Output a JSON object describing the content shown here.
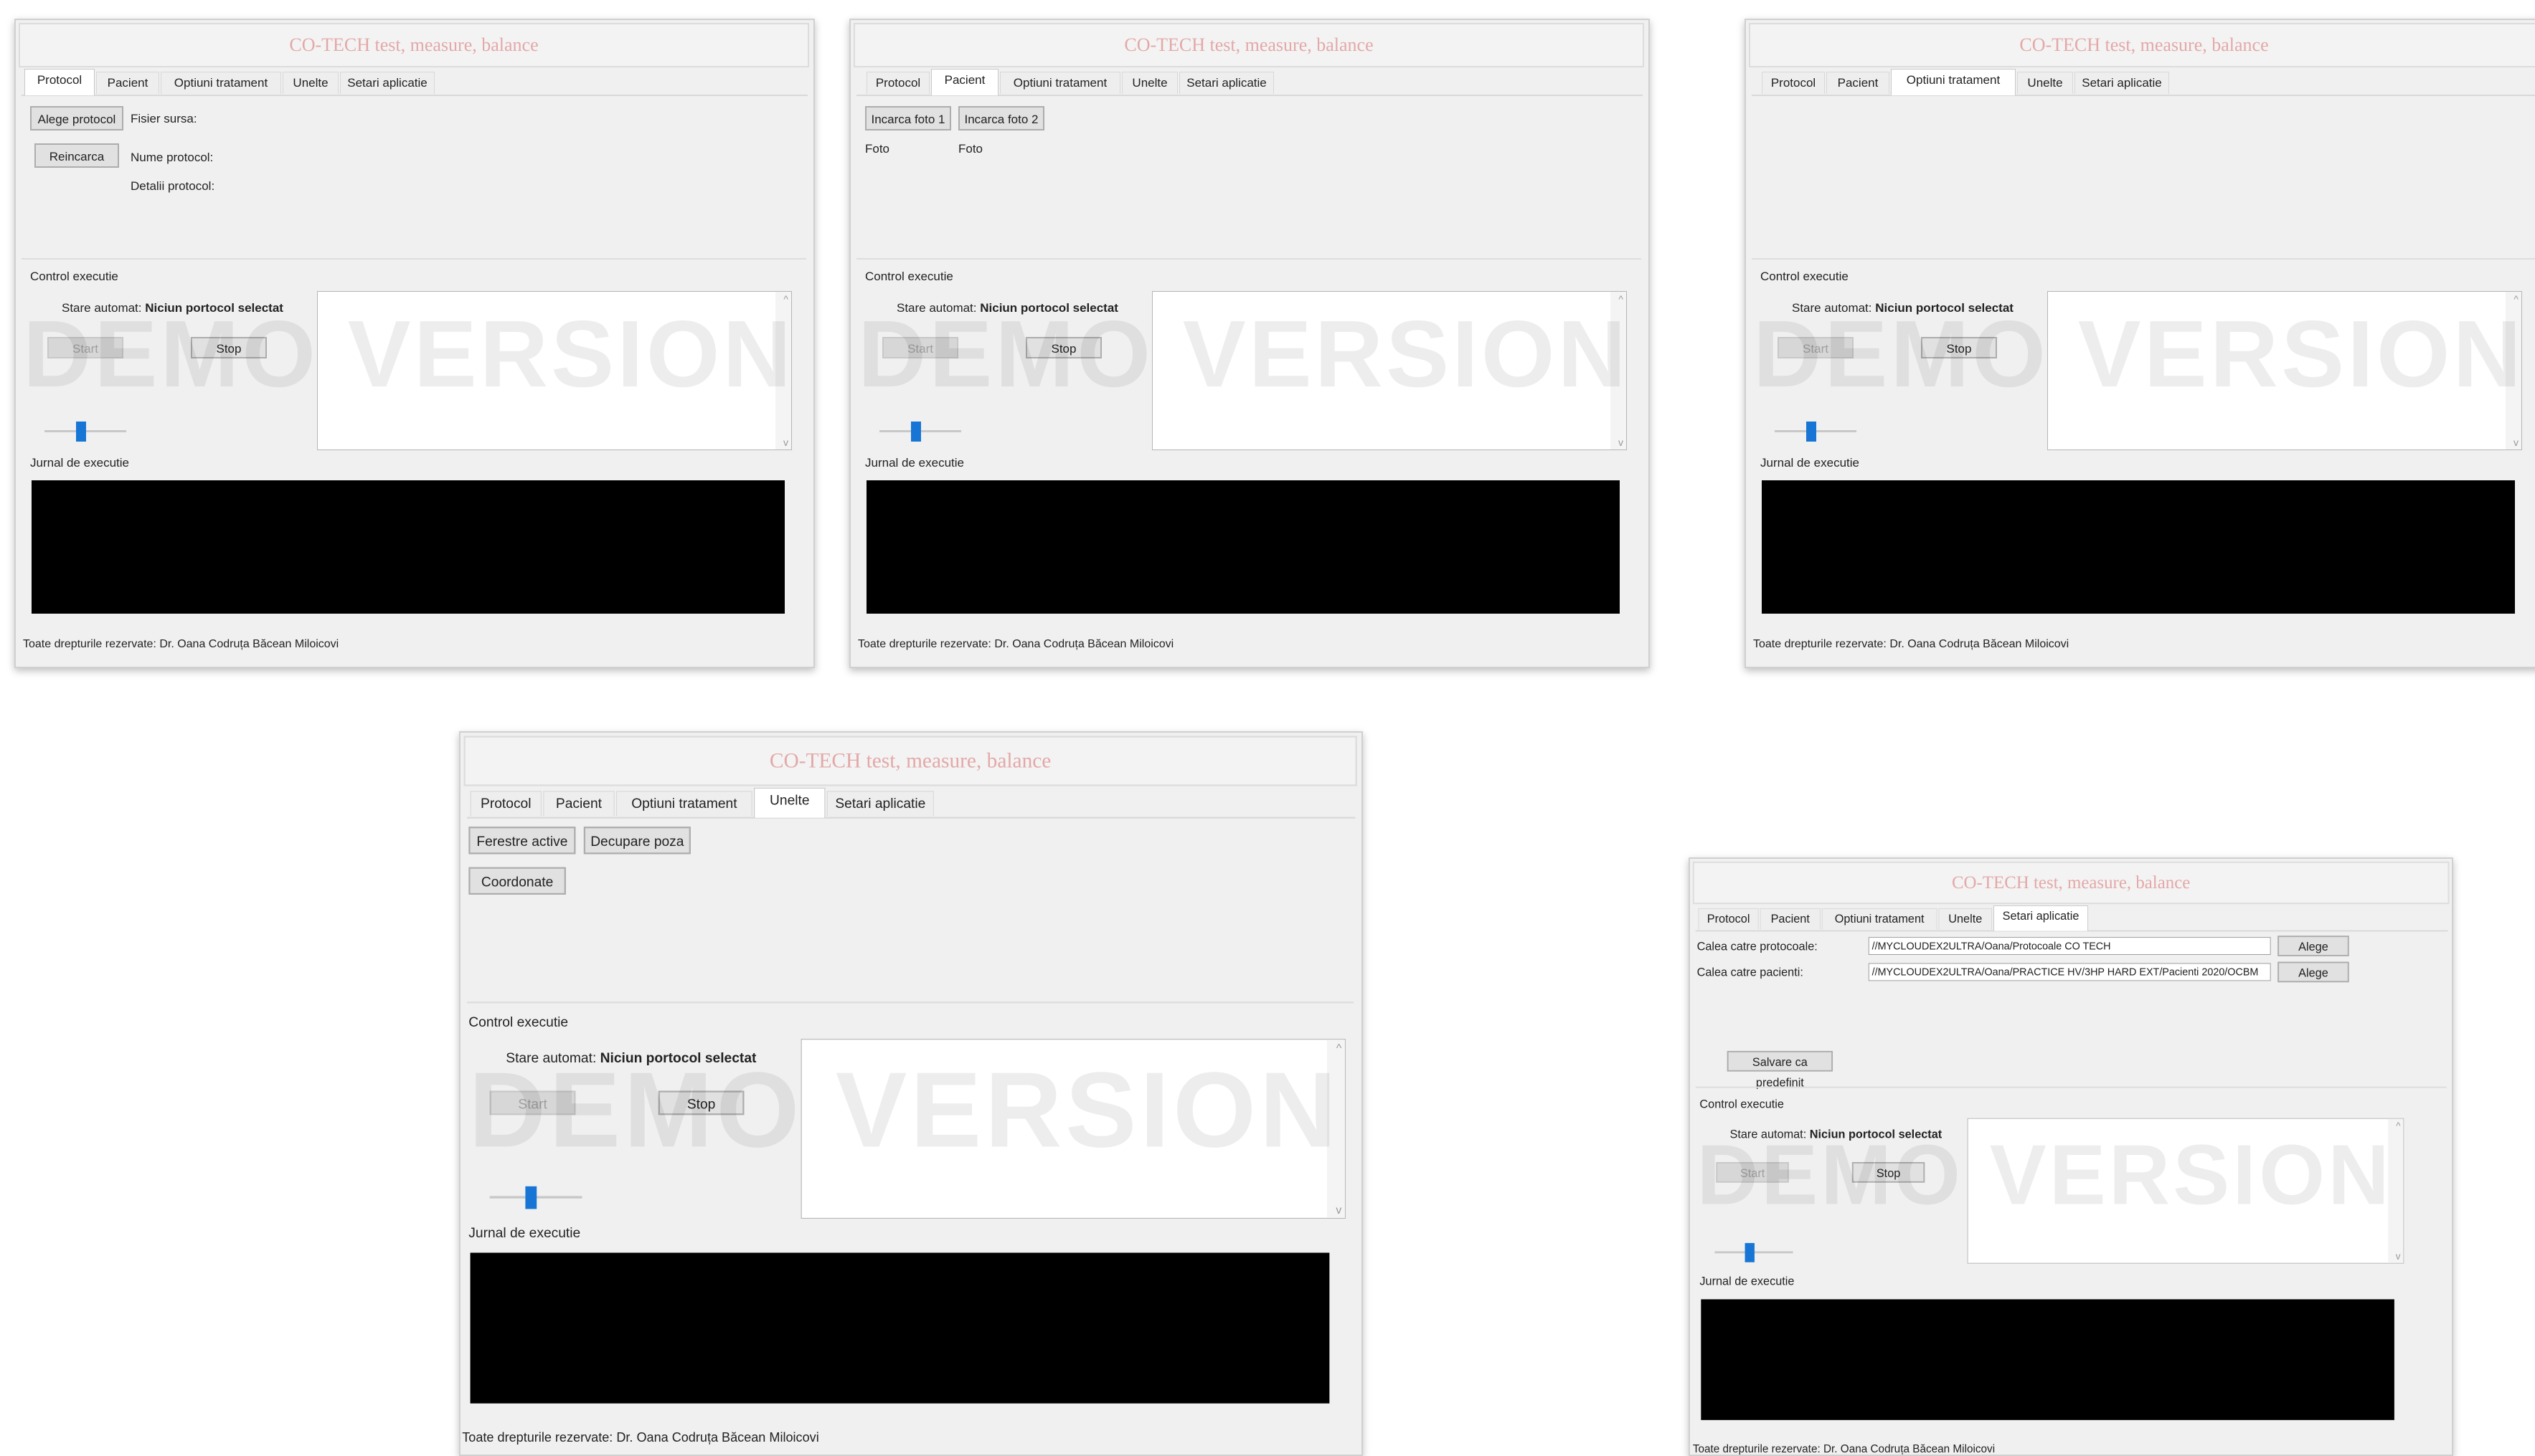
{
  "app": {
    "title": "CO-TECH test, measure, balance",
    "tabs": [
      "Protocol",
      "Pacient",
      "Optiuni tratament",
      "Unelte",
      "Setari aplicatie"
    ],
    "control_label": "Control executie",
    "state_label": "Stare automat:",
    "state_value": "Niciun portocol selectat",
    "start_label": "Start",
    "stop_label": "Stop",
    "log_label": "Jurnal de executie",
    "watermark": "DEMO VERSION",
    "footer": "Toate drepturile rezervate: Dr. Oana Codruța Băcean Miloicovi"
  },
  "protocol_tab": {
    "choose_button": "Alege protocol",
    "source_label": "Fisier sursa:",
    "reload_button": "Reincarca",
    "name_label": "Nume protocol:",
    "details_label": "Detalii protocol:"
  },
  "pacient_tab": {
    "load1_button": "Incarca foto 1",
    "load2_button": "Incarca foto 2",
    "foto1_label": "Foto",
    "foto2_label": "Foto"
  },
  "unelte_tab": {
    "active_windows_button": "Ferestre active",
    "crop_button": "Decupare poza",
    "coords_button": "Coordonate"
  },
  "settings_tab": {
    "protocols_path_label": "Calea catre protocoale:",
    "protocols_path_value": "//MYCLOUDEX2ULTRA/Oana/Protocoale CO TECH",
    "patients_path_label": "Calea catre pacienti:",
    "patients_path_value": "//MYCLOUDEX2ULTRA/Oana/PRACTICE HV/3HP HARD EXT/Pacienti 2020/OCBM",
    "choose_button": "Alege",
    "save_default_button": "Salvare ca predefinit"
  },
  "slider_level": 0.45
}
